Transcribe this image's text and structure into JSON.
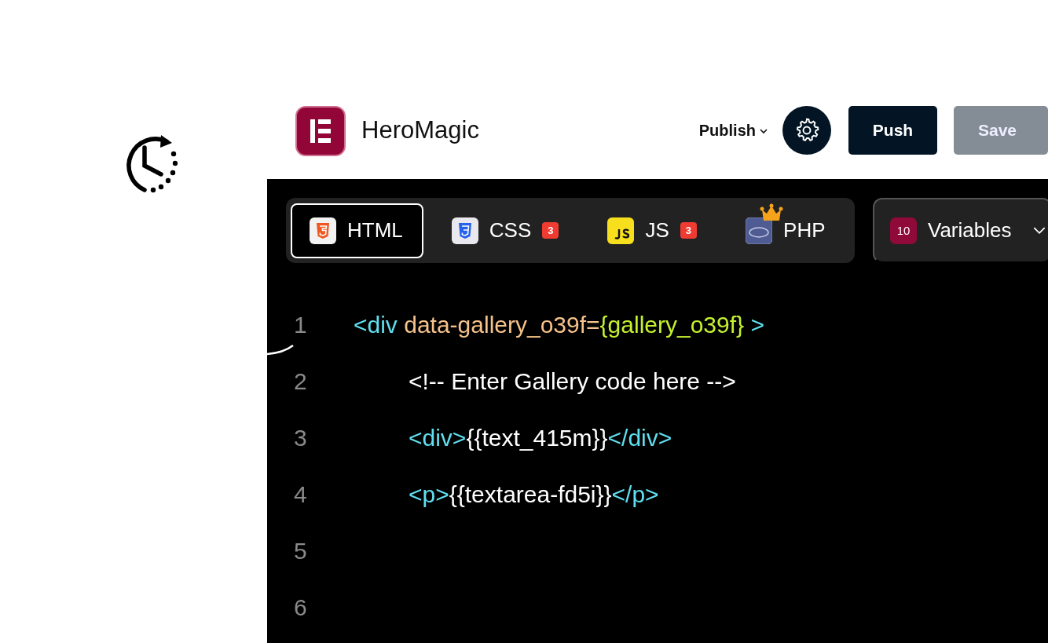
{
  "header": {
    "app_name": "HeroMagic",
    "publish": "Publish",
    "push": "Push",
    "save": {
      "label": "Save",
      "disabled": true
    }
  },
  "tabs": [
    {
      "label": "HTML",
      "kind": "html",
      "selected": true
    },
    {
      "label": "CSS",
      "kind": "css",
      "selected": false,
      "badge": "3"
    },
    {
      "label": "JS",
      "kind": "js",
      "selected": false,
      "badge": "3"
    },
    {
      "label": "PHP",
      "kind": "php",
      "selected": false,
      "pro": true
    }
  ],
  "variables": {
    "count": "10",
    "label": "Variables"
  },
  "code_lines": [
    {
      "number": "1",
      "tokens": [
        {
          "kind": "tag",
          "text": "<div "
        },
        {
          "kind": "attr",
          "text": "data-gallery_o39f="
        },
        {
          "kind": "expr",
          "text": "{gallery_o39f}"
        },
        {
          "kind": "tag",
          "text": " >"
        }
      ],
      "children": [
        {
          "number": "2",
          "tokens": [
            {
              "kind": "plain",
              "text": "<!-- Enter Gallery code here -->"
            }
          ]
        },
        {
          "number": "3",
          "tokens": [
            {
              "kind": "tag",
              "text": "<div>"
            },
            {
              "kind": "plain",
              "text": "{{text_415m}}"
            },
            {
              "kind": "tag",
              "text": "</div>"
            }
          ]
        },
        {
          "number": "4",
          "tokens": [
            {
              "kind": "tag",
              "text": "<p>"
            },
            {
              "kind": "plain",
              "text": "{{textarea-fd5i}}"
            },
            {
              "kind": "tag",
              "text": "</p>"
            }
          ]
        }
      ]
    },
    {
      "number": "5"
    },
    {
      "number": "6"
    }
  ]
}
